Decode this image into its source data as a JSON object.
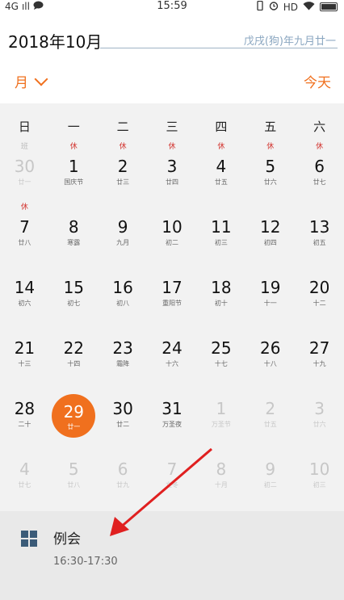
{
  "status_bar": {
    "network": "4G",
    "signal": "ıll",
    "time": "15:59",
    "hd": "HD"
  },
  "header": {
    "title": "2018年10月",
    "lunar_date": "戊戌(狗)年九月廿一"
  },
  "view": {
    "mode_label": "月",
    "today_label": "今天"
  },
  "weekdays": [
    "日",
    "一",
    "二",
    "三",
    "四",
    "五",
    "六"
  ],
  "weekday_badges": [
    "班",
    "休",
    "休",
    "休",
    "休",
    "休",
    "休"
  ],
  "calendar": {
    "rows": [
      [
        {
          "day": "30",
          "lunar": "廿一",
          "dim": true
        },
        {
          "day": "1",
          "lunar": "国庆节"
        },
        {
          "day": "2",
          "lunar": "廿三"
        },
        {
          "day": "3",
          "lunar": "廿四"
        },
        {
          "day": "4",
          "lunar": "廿五"
        },
        {
          "day": "5",
          "lunar": "廿六"
        },
        {
          "day": "6",
          "lunar": "廿七"
        }
      ],
      [
        {
          "day": "7",
          "lunar": "廿八",
          "badge": "休"
        },
        {
          "day": "8",
          "lunar": "寒露"
        },
        {
          "day": "9",
          "lunar": "九月"
        },
        {
          "day": "10",
          "lunar": "初二"
        },
        {
          "day": "11",
          "lunar": "初三"
        },
        {
          "day": "12",
          "lunar": "初四"
        },
        {
          "day": "13",
          "lunar": "初五"
        }
      ],
      [
        {
          "day": "14",
          "lunar": "初六"
        },
        {
          "day": "15",
          "lunar": "初七"
        },
        {
          "day": "16",
          "lunar": "初八"
        },
        {
          "day": "17",
          "lunar": "重阳节"
        },
        {
          "day": "18",
          "lunar": "初十"
        },
        {
          "day": "19",
          "lunar": "十一"
        },
        {
          "day": "20",
          "lunar": "十二"
        }
      ],
      [
        {
          "day": "21",
          "lunar": "十三"
        },
        {
          "day": "22",
          "lunar": "十四"
        },
        {
          "day": "23",
          "lunar": "霜降"
        },
        {
          "day": "24",
          "lunar": "十六"
        },
        {
          "day": "25",
          "lunar": "十七"
        },
        {
          "day": "26",
          "lunar": "十八"
        },
        {
          "day": "27",
          "lunar": "十九"
        }
      ],
      [
        {
          "day": "28",
          "lunar": "二十"
        },
        {
          "day": "29",
          "lunar": "廿一",
          "selected": true
        },
        {
          "day": "30",
          "lunar": "廿二"
        },
        {
          "day": "31",
          "lunar": "万圣夜"
        },
        {
          "day": "1",
          "lunar": "万圣节",
          "dim": true
        },
        {
          "day": "2",
          "lunar": "廿五",
          "dim": true
        },
        {
          "day": "3",
          "lunar": "廿六",
          "dim": true
        }
      ],
      [
        {
          "day": "4",
          "lunar": "廿七",
          "dim": true
        },
        {
          "day": "5",
          "lunar": "廿八",
          "dim": true
        },
        {
          "day": "6",
          "lunar": "廿九",
          "dim": true
        },
        {
          "day": "7",
          "lunar": "立冬",
          "dim": true
        },
        {
          "day": "8",
          "lunar": "十月",
          "dim": true
        },
        {
          "day": "9",
          "lunar": "初二",
          "dim": true
        },
        {
          "day": "10",
          "lunar": "初三",
          "dim": true
        }
      ]
    ]
  },
  "event": {
    "title": "例会",
    "time": "16:30-17:30"
  },
  "colors": {
    "accent": "#f0701e",
    "holiday_badge": "#d2322d",
    "panel": "#f2f2f2"
  }
}
